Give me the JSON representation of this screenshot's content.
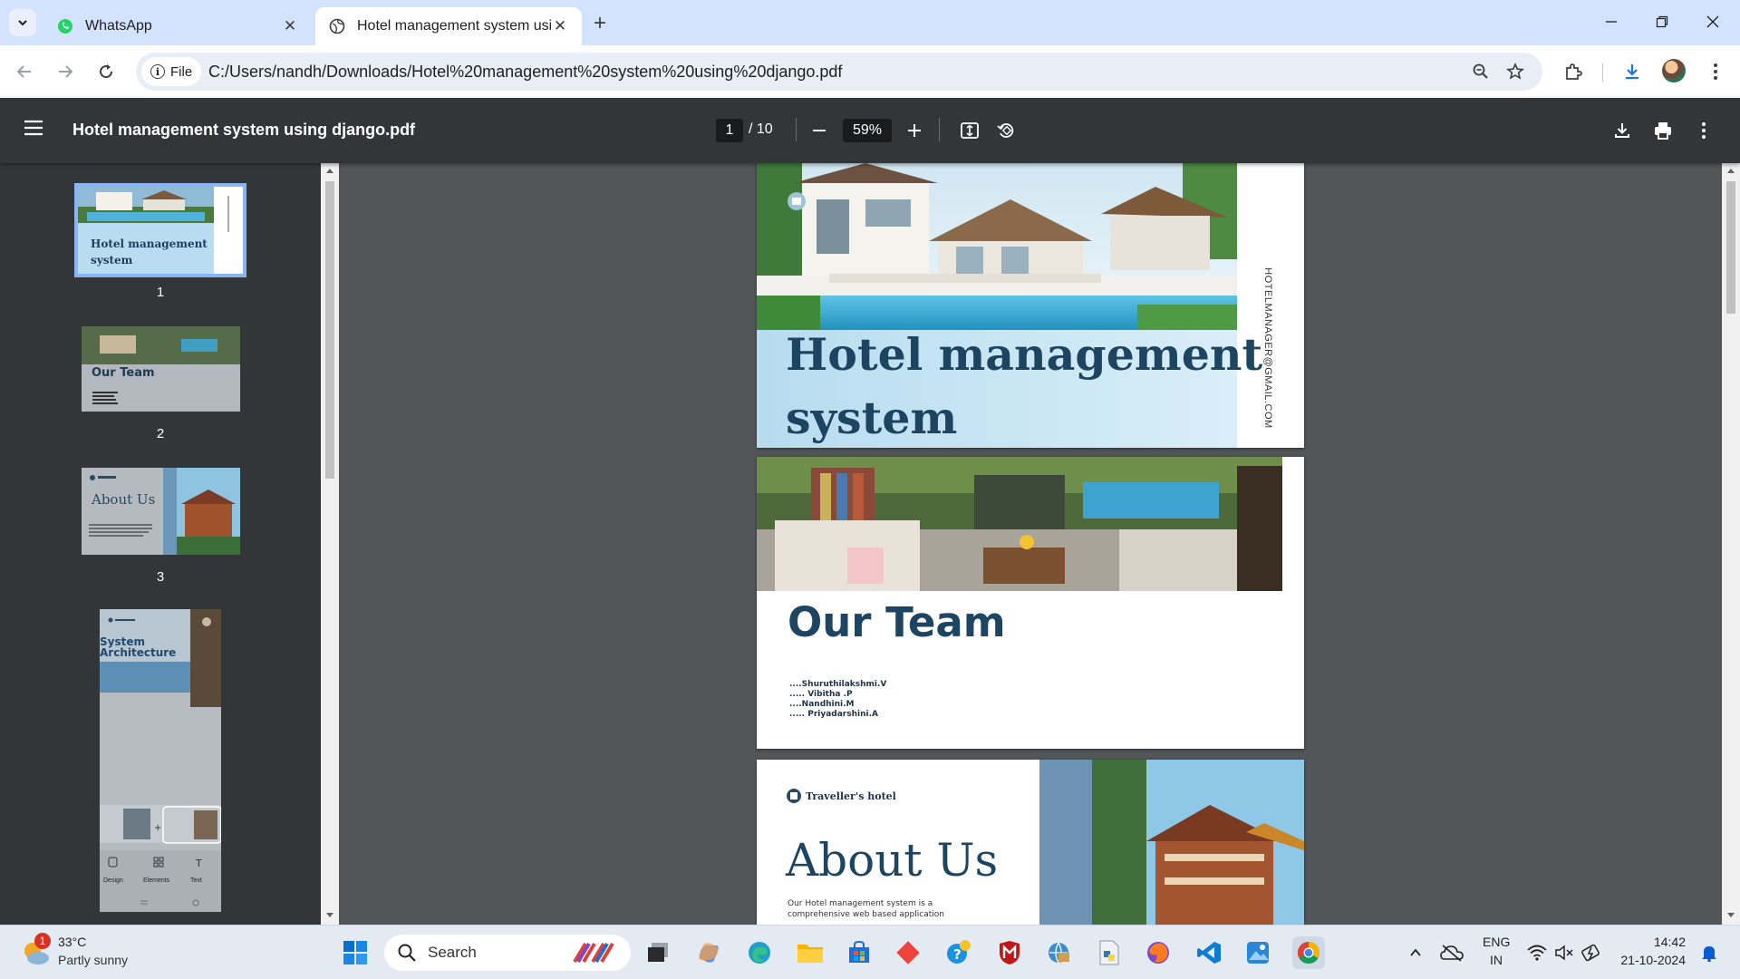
{
  "tabs": [
    {
      "title": "WhatsApp",
      "favicon": "whatsapp-icon"
    },
    {
      "title": "Hotel management system usin",
      "favicon": "globe-icon"
    }
  ],
  "toolbar": {
    "chip_label": "File",
    "url": "C:/Users/nandh/Downloads/Hotel%20management%20system%20using%20django.pdf"
  },
  "pdf": {
    "title": "Hotel management system using django.pdf",
    "current_page": "1",
    "page_total": "/ 10",
    "zoom": "59%"
  },
  "thumbnails": [
    {
      "number": "1",
      "caption": "Hotel management system"
    },
    {
      "number": "2",
      "caption": "Our Team"
    },
    {
      "number": "3",
      "caption": "About Us"
    },
    {
      "number": "4",
      "caption": "System Architecture",
      "toolbar": [
        "Design",
        "Elements",
        "Text"
      ]
    }
  ],
  "pages": {
    "page1": {
      "title_line1": "Hotel management",
      "title_line2": "system",
      "side_text": "HOTELMANAGER@GMAIL.COM"
    },
    "page2": {
      "heading": "Our Team",
      "members": [
        "....Shuruthilakshmi.V",
        "..... Vibitha .P",
        "....Nandhini.M",
        "..... Priyadarshini.A"
      ]
    },
    "page3": {
      "brand": "Traveller's hotel",
      "heading": "About Us",
      "body_line1": "Our Hotel management system is a",
      "body_line2": "comprehensive web based application"
    }
  },
  "taskbar": {
    "weather_temp": "33°C",
    "weather_desc": "Partly sunny",
    "weather_badge": "1",
    "search_label": "Search",
    "lang_line1": "ENG",
    "lang_line2": "IN",
    "time": "14:42",
    "date": "21-10-2024"
  }
}
